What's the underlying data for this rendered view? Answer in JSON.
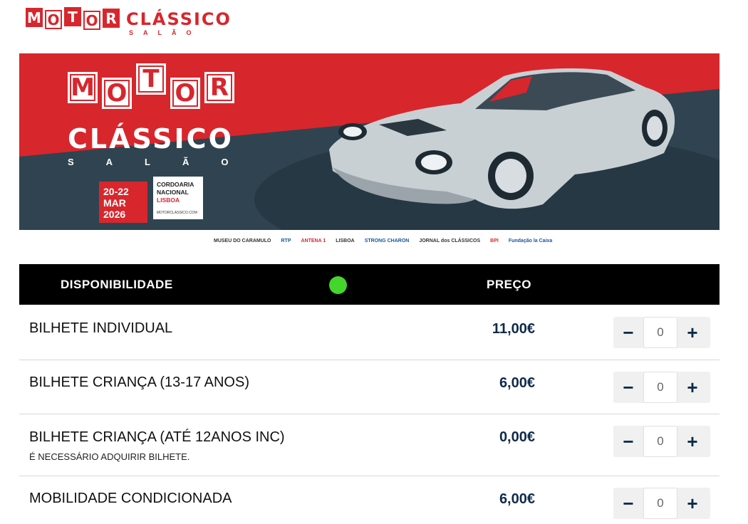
{
  "logo": {
    "tiles": [
      "M",
      "O",
      "T",
      "O",
      "R"
    ],
    "word": "CLÁSSICO",
    "sub": "SALÃO"
  },
  "banner": {
    "tiles": [
      "M",
      "O",
      "T",
      "O",
      "R"
    ],
    "word": "CLÁSSICO",
    "sub": "SALÃO",
    "date_line1": "20-22",
    "date_line2": "MAR",
    "date_line3": "2026",
    "venue_line1": "CORDOARIA",
    "venue_line2": "NACIONAL",
    "venue_city": "LISBOA",
    "venue_url": "MOTORCLASSICO.COM"
  },
  "sponsors": [
    "MUSEU DO CARAMULO",
    "RTP",
    "ANTENA 1",
    "LISBOA",
    "STRONG CHARON",
    "JORNAL dos CLÁSSICOS",
    "BPI",
    "Fundação la Caixa"
  ],
  "table": {
    "col_availability": "DISPONIBILIDADE",
    "col_price": "PREÇO",
    "availability_color": "#44d62c"
  },
  "tickets": [
    {
      "name": "BILHETE INDIVIDUAL",
      "note": "",
      "price": "11,00€",
      "qty": "0"
    },
    {
      "name": "BILHETE CRIANÇA (13-17 ANOS)",
      "note": "",
      "price": "6,00€",
      "qty": "0"
    },
    {
      "name": "BILHETE CRIANÇA (ATÉ 12ANOS INC)",
      "note": "É NECESSÁRIO ADQUIRIR BILHETE.",
      "price": "0,00€",
      "qty": "0"
    },
    {
      "name": "MOBILIDADE CONDICIONADA",
      "note": "",
      "price": "6,00€",
      "qty": "0"
    }
  ],
  "stepper": {
    "minus": "−",
    "plus": "+"
  },
  "colors": {
    "brand_red": "#d8262d",
    "dark_slate": "#2f4450",
    "price_navy": "#0f2a4a"
  }
}
